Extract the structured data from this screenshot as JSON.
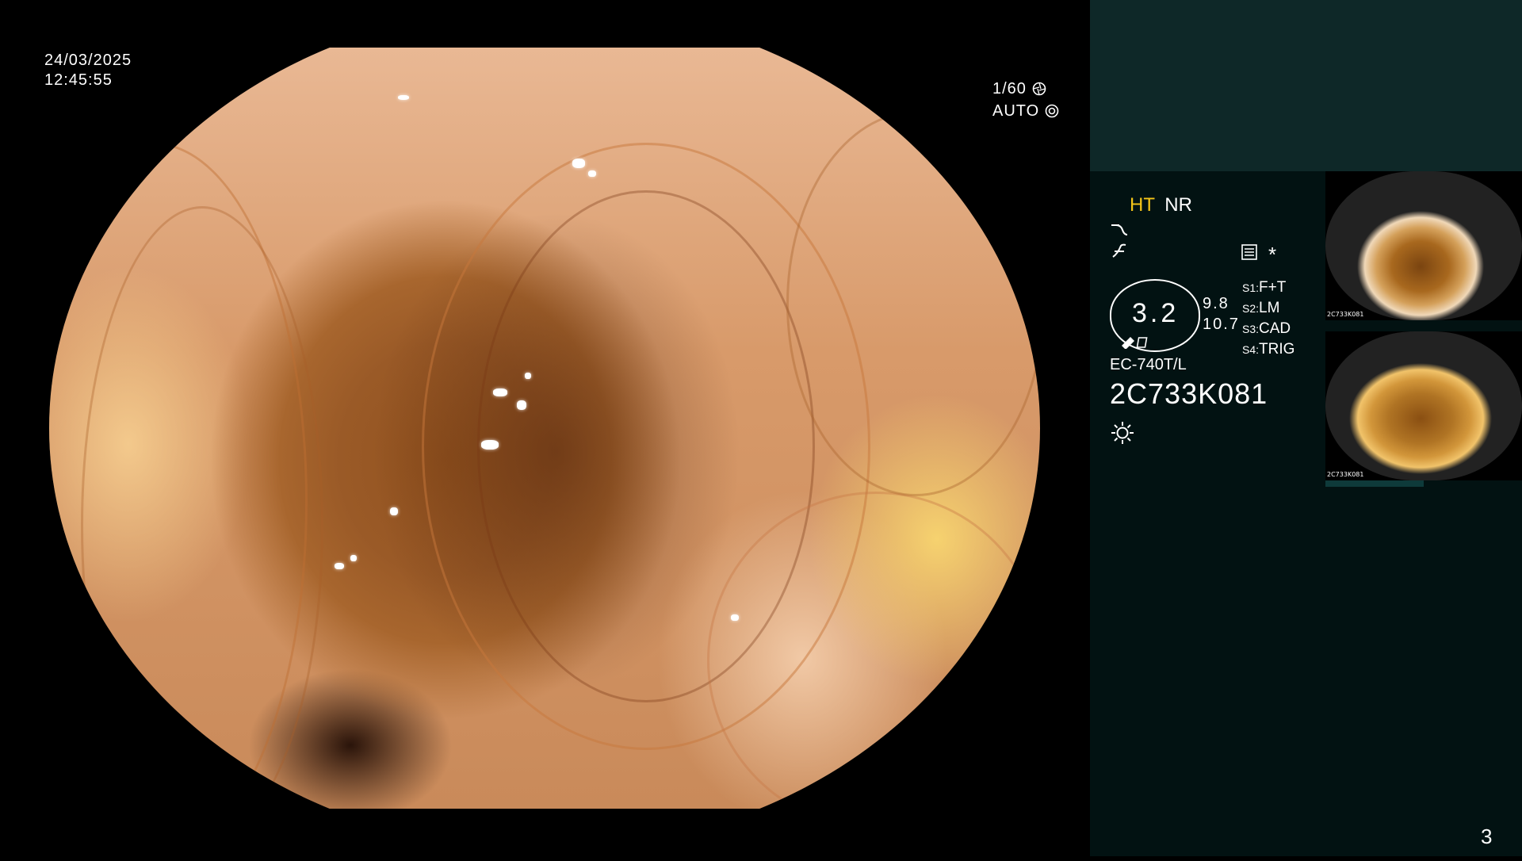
{
  "overlay": {
    "date": "24/03/2025",
    "time": "12:45:55",
    "shutter": "1/60",
    "shutter_icon": "aperture-icon",
    "iris": "AUTO",
    "iris_icon": "target-icon"
  },
  "panel": {
    "mode_ht": "HT",
    "mode_nr": "NR",
    "zoom_value": "3.2",
    "value_top": "9.8",
    "value_bottom": "10.7",
    "switches": [
      {
        "key": "S1:",
        "value": "F+T"
      },
      {
        "key": "S2:",
        "value": "LM"
      },
      {
        "key": "S3:",
        "value": "CAD"
      },
      {
        "key": "S4:",
        "value": "TRIG"
      }
    ],
    "asterisk": "*",
    "scope_model": "EC-740T/L",
    "serial": "2C733K081",
    "page_number": "3",
    "thumbnail_1_label": "2C733K081",
    "thumbnail_2_label": "2C733K081",
    "colors": {
      "ht": "#f5c518",
      "panel_bg": "#021212",
      "panel_top": "#0e2828"
    }
  }
}
